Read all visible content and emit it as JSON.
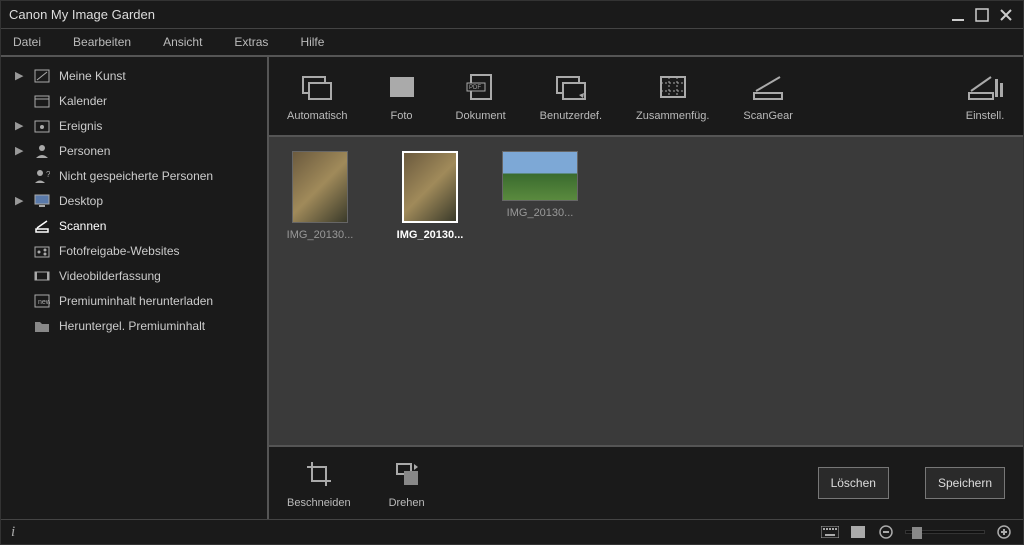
{
  "window": {
    "title": "Canon My Image Garden"
  },
  "menu": {
    "items": [
      "Datei",
      "Bearbeiten",
      "Ansicht",
      "Extras",
      "Hilfe"
    ]
  },
  "sidebar": {
    "items": [
      {
        "label": "Meine Kunst",
        "expandable": true,
        "icon": "palette"
      },
      {
        "label": "Kalender",
        "expandable": false,
        "icon": "calendar"
      },
      {
        "label": "Ereignis",
        "expandable": true,
        "icon": "event"
      },
      {
        "label": "Personen",
        "expandable": true,
        "icon": "person"
      },
      {
        "label": "Nicht gespeicherte Personen",
        "expandable": false,
        "icon": "person-unknown"
      },
      {
        "label": "Desktop",
        "expandable": true,
        "icon": "desktop"
      },
      {
        "label": "Scannen",
        "expandable": false,
        "icon": "scanner",
        "active": true
      },
      {
        "label": "Fotofreigabe-Websites",
        "expandable": false,
        "icon": "share"
      },
      {
        "label": "Videobilderfassung",
        "expandable": false,
        "icon": "video"
      },
      {
        "label": "Premiuminhalt herunterladen",
        "expandable": false,
        "icon": "download"
      },
      {
        "label": "Heruntergel. Premiuminhalt",
        "expandable": false,
        "icon": "folder"
      }
    ]
  },
  "toolbarTop": {
    "items": [
      {
        "label": "Automatisch",
        "icon": "auto"
      },
      {
        "label": "Foto",
        "icon": "photo"
      },
      {
        "label": "Dokument",
        "icon": "pdf"
      },
      {
        "label": "Benutzerdef.",
        "icon": "custom"
      },
      {
        "label": "Zusammenfüg.",
        "icon": "stitch"
      },
      {
        "label": "ScanGear",
        "icon": "scangear"
      }
    ],
    "settings": {
      "label": "Einstell.",
      "icon": "settings"
    }
  },
  "thumbs": [
    {
      "label": "IMG_20130...",
      "orient": "portrait",
      "selected": false
    },
    {
      "label": "IMG_20130...",
      "orient": "portrait",
      "selected": true
    },
    {
      "label": "IMG_20130...",
      "orient": "landscape",
      "selected": false
    }
  ],
  "toolbarBottom": {
    "items": [
      {
        "label": "Beschneiden",
        "icon": "crop"
      },
      {
        "label": "Drehen",
        "icon": "rotate"
      }
    ],
    "delete": "Löschen",
    "save": "Speichern"
  },
  "status": {
    "info": "i"
  }
}
